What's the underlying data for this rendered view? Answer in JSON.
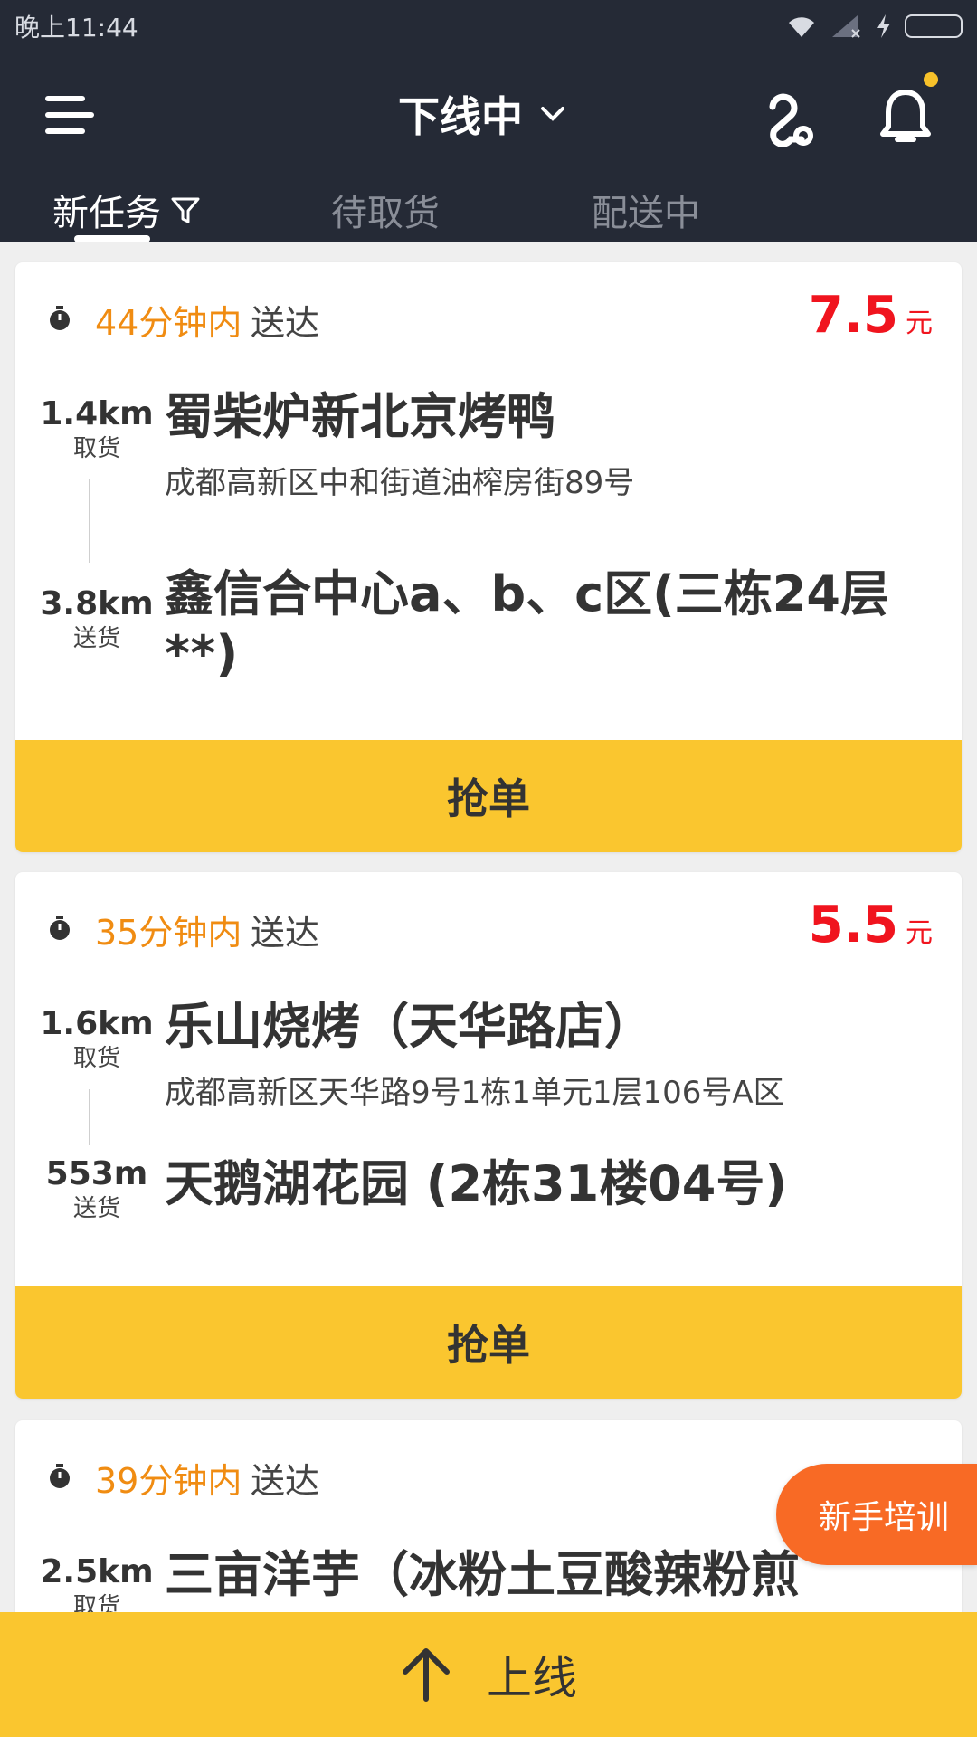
{
  "status_bar": {
    "time": "晚上11:44"
  },
  "header": {
    "status_label": "下线中",
    "tabs": [
      {
        "label": "新任务",
        "active": true
      },
      {
        "label": "待取货",
        "active": false
      },
      {
        "label": "配送中",
        "active": false
      }
    ]
  },
  "orders": [
    {
      "eta": "44分钟内",
      "eta_suffix": "送达",
      "price": "7.5",
      "price_unit": "元",
      "pickup": {
        "distance": "1.4km",
        "label": "取货",
        "name": "蜀柴炉新北京烤鸭",
        "address": "成都高新区中和街道油榨房街89号"
      },
      "dropoff": {
        "distance": "3.8km",
        "label": "送货",
        "name": "鑫信合中心a、b、c区(三栋24层**)"
      },
      "button": "抢单"
    },
    {
      "eta": "35分钟内",
      "eta_suffix": "送达",
      "price": "5.5",
      "price_unit": "元",
      "pickup": {
        "distance": "1.6km",
        "label": "取货",
        "name": "乐山烧烤（天华路店）",
        "address": "成都高新区天华路9号1栋1单元1层106号A区"
      },
      "dropoff": {
        "distance": "553m",
        "label": "送货",
        "name": "天鹅湖花园 (2栋31楼04号)"
      },
      "button": "抢单"
    },
    {
      "eta": "39分钟内",
      "eta_suffix": "送达",
      "pickup": {
        "distance": "2.5km",
        "label": "取货",
        "name": "三亩洋芋（冰粉土豆酸辣粉煎"
      }
    }
  ],
  "training_button": "新手培训",
  "online_button": "上线",
  "colors": {
    "header_bg": "#252a36",
    "accent_yellow": "#fac62f",
    "eta_orange": "#f08c12",
    "price_red": "#f0141e",
    "training_orange": "#f86a25"
  }
}
